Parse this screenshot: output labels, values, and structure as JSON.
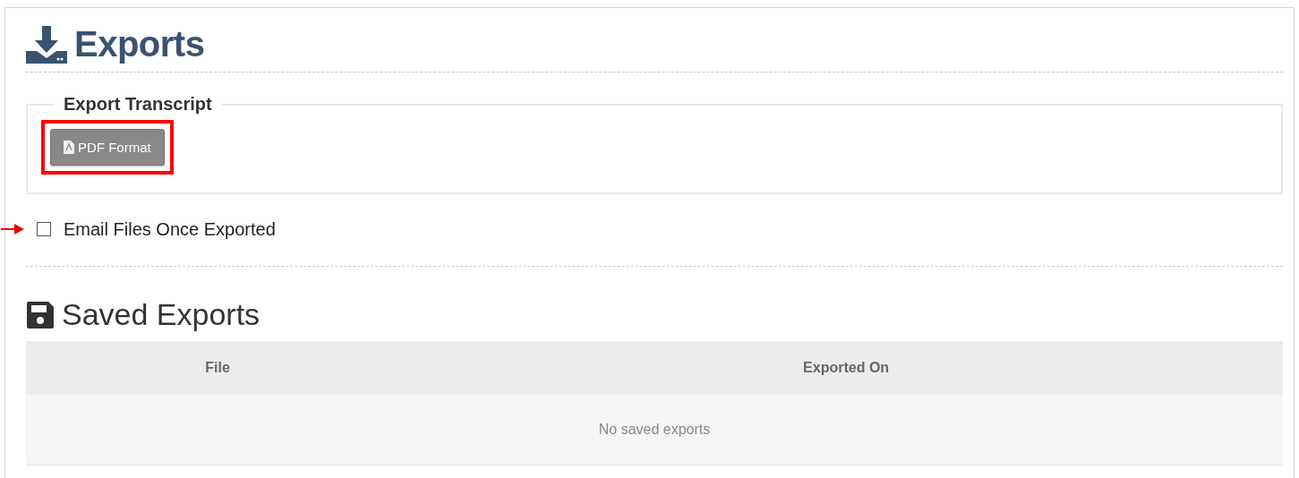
{
  "title": "Exports",
  "export_section": {
    "legend": "Export Transcript",
    "button": {
      "label": "PDF Format",
      "highlighted": true
    }
  },
  "email_option": {
    "label": "Email Files Once Exported",
    "checked": false,
    "pointed": true
  },
  "saved_title": "Saved Exports",
  "table": {
    "columns": [
      "File",
      "Exported On"
    ],
    "empty_message": "No saved exports"
  }
}
